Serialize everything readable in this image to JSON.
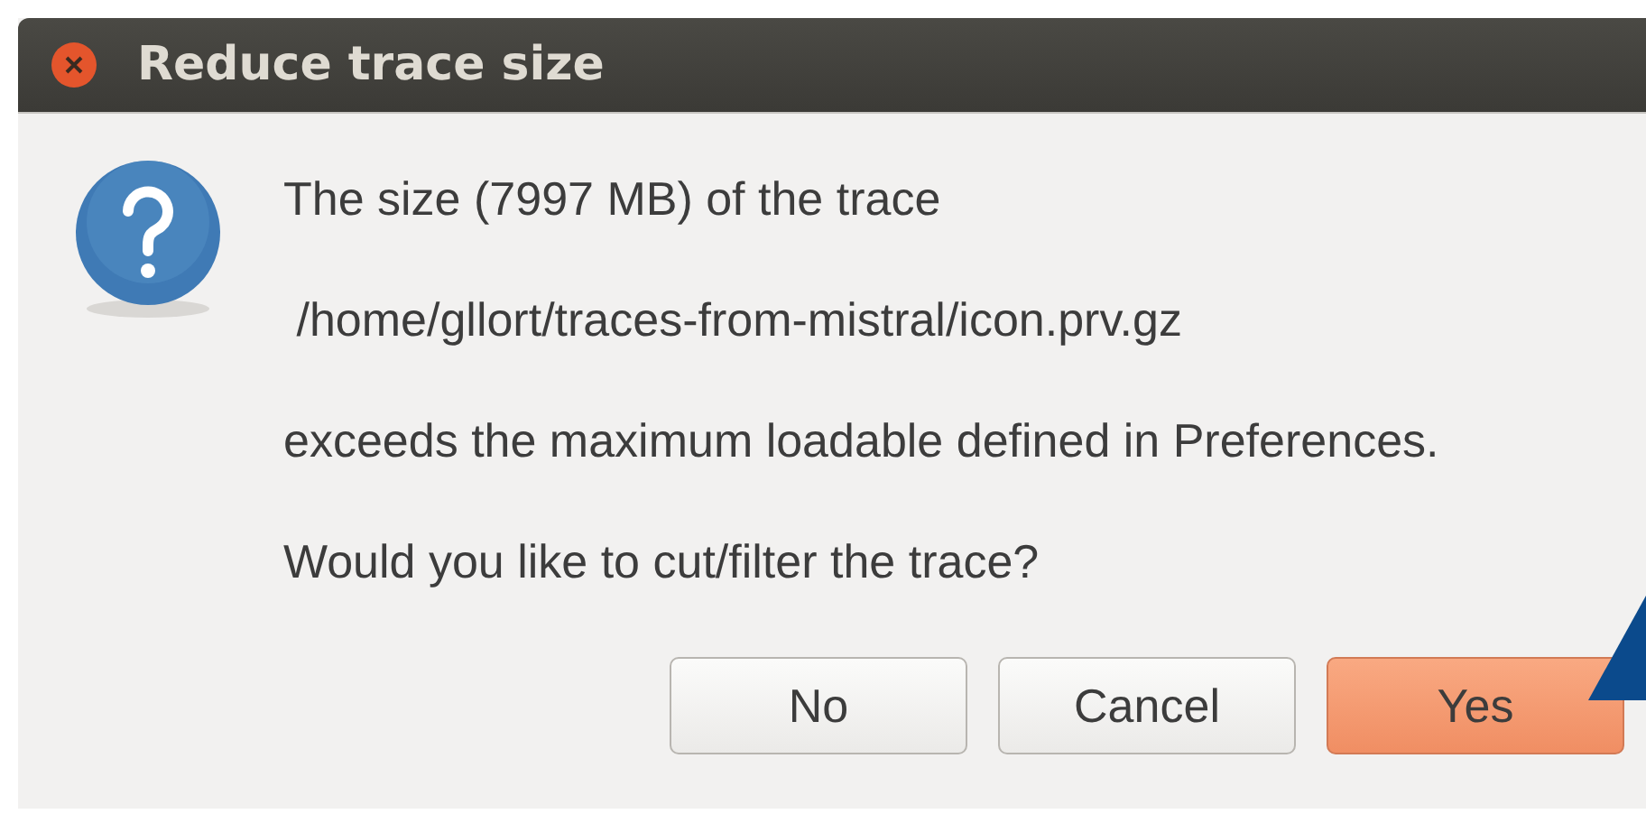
{
  "window": {
    "title": "Reduce trace size"
  },
  "message": {
    "lines": [
      "The size (7997 MB) of the trace",
      " /home/gllort/traces-from-mistral/icon.prv.gz",
      "exceeds the maximum loadable defined in Preferences.",
      "Would you like to cut/filter the trace?"
    ]
  },
  "buttons": [
    {
      "label": "No",
      "default": false
    },
    {
      "label": "Cancel",
      "default": false
    },
    {
      "label": "Yes",
      "default": true
    }
  ]
}
